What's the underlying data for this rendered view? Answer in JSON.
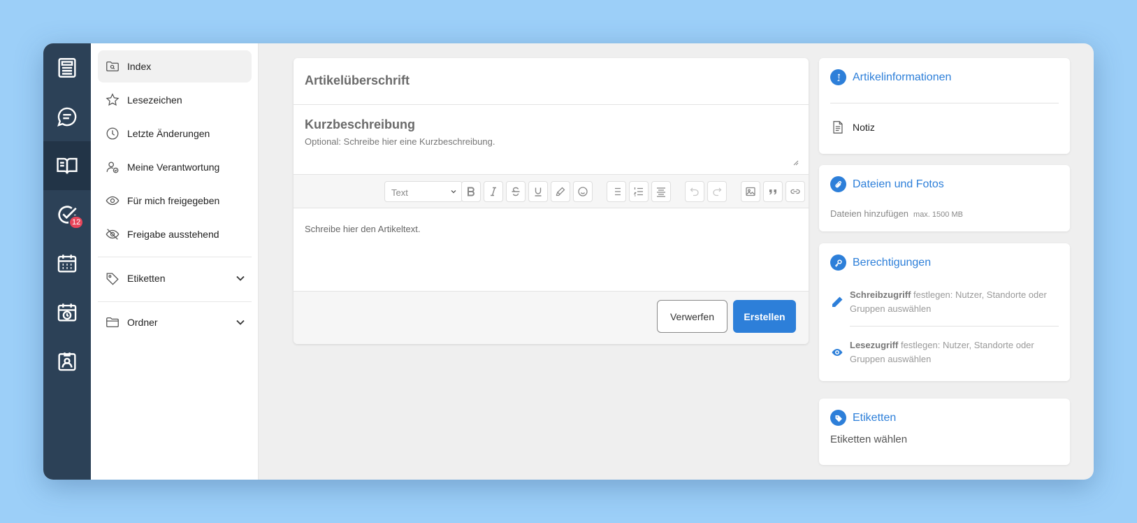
{
  "rail": {
    "items": [
      {
        "icon": "newspaper-icon",
        "active": false
      },
      {
        "icon": "chat-icon",
        "active": false
      },
      {
        "icon": "book-icon",
        "active": true
      },
      {
        "icon": "task-check-icon",
        "active": false,
        "badge": "12"
      },
      {
        "icon": "calendar-icon",
        "active": false
      },
      {
        "icon": "calendar-clock-icon",
        "active": false
      },
      {
        "icon": "contact-card-icon",
        "active": false
      }
    ]
  },
  "nav": {
    "items": [
      {
        "label": "Index",
        "icon": "folder-search-icon",
        "active": true
      },
      {
        "label": "Lesezeichen",
        "icon": "star-icon"
      },
      {
        "label": "Letzte Änderungen",
        "icon": "clock-icon"
      },
      {
        "label": "Meine Verantwortung",
        "icon": "user-check-icon"
      },
      {
        "label": "Für mich freigegeben",
        "icon": "eye-icon"
      },
      {
        "label": "Freigabe ausstehend",
        "icon": "eye-off-icon"
      }
    ],
    "groups": [
      {
        "label": "Etiketten",
        "icon": "tag-icon",
        "expandable": true
      },
      {
        "label": "Ordner",
        "icon": "folder-icon",
        "expandable": true
      }
    ]
  },
  "editor": {
    "title_placeholder": "Artikelüberschrift",
    "short_heading": "Kurzbeschreibung",
    "short_placeholder": "Optional: Schreibe hier eine Kurzbeschreibung.",
    "format_select": "Text",
    "toolbar_icons": [
      "bold-icon",
      "italic-icon",
      "strikethrough-icon",
      "underline-icon",
      "highlighter-icon",
      "emoji-icon",
      "bullet-list-icon",
      "numbered-list-icon",
      "align-icon",
      "undo-icon",
      "redo-icon",
      "image-icon",
      "quote-icon",
      "link-icon"
    ],
    "body_placeholder": "Schreibe hier den Artikeltext.",
    "discard_label": "Verwerfen",
    "create_label": "Erstellen"
  },
  "side": {
    "info": {
      "title": "Artikelinformationen",
      "type_label": "Notiz"
    },
    "files": {
      "title": "Dateien und Fotos",
      "add_label": "Dateien hinzufügen",
      "max_label": "max. 1500 MB"
    },
    "perms": {
      "title": "Berechtigungen",
      "write_bold": "Schreibzugriff",
      "write_text": " festlegen: Nutzer, Standorte oder Gruppen auswählen",
      "read_bold": "Lesezugriff",
      "read_text": " festlegen: Nutzer, Standorte oder Gruppen auswählen"
    },
    "tags": {
      "title": "Etiketten",
      "choose_label": "Etiketten wählen"
    }
  },
  "colors": {
    "accent": "#2d7fd9",
    "rail": "#2c4157",
    "background": "#9ccff8",
    "badge": "#e8455a"
  }
}
